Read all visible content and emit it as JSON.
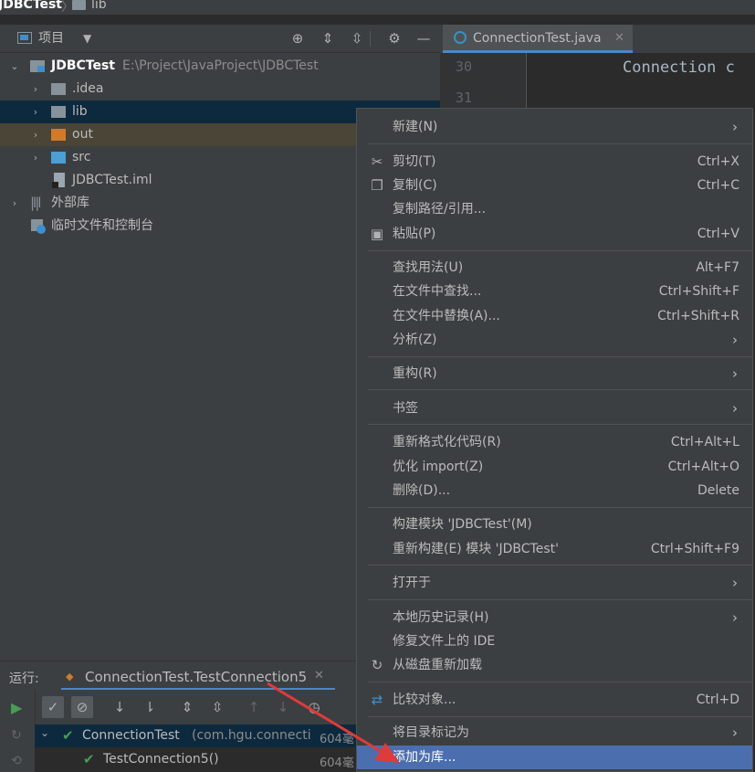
{
  "breadcrumb": {
    "project": "JDBCTest",
    "folder": "lib"
  },
  "project_panel": {
    "view_label": "项目",
    "tree": {
      "root_label": "JDBCTest",
      "root_path": "E:\\Project\\JavaProject\\JDBCTest",
      "items": [
        {
          "label": ".idea"
        },
        {
          "label": "lib"
        },
        {
          "label": "out"
        },
        {
          "label": "src"
        },
        {
          "label": "JDBCTest.iml"
        },
        {
          "label": "外部库"
        },
        {
          "label": "临时文件和控制台"
        }
      ]
    }
  },
  "editor": {
    "tab_label": "ConnectionTest.java",
    "line_numbers": [
      "30",
      "31"
    ],
    "line_30": "Connection c"
  },
  "run": {
    "label": "运行:",
    "tab_label": "ConnectionTest.TestConnection5",
    "tests": [
      {
        "name": "ConnectionTest",
        "detail": "(com.hgu.connecti",
        "time": "604毫"
      },
      {
        "name": "TestConnection5()",
        "detail": "",
        "time": "604毫"
      }
    ]
  },
  "context_menu": {
    "items": [
      {
        "label": "新建(N)",
        "shortcut": ""
      },
      {
        "label": "剪切(T)",
        "shortcut": "Ctrl+X"
      },
      {
        "label": "复制(C)",
        "shortcut": "Ctrl+C"
      },
      {
        "label": "复制路径/引用...",
        "shortcut": ""
      },
      {
        "label": "粘贴(P)",
        "shortcut": "Ctrl+V"
      },
      {
        "label": "查找用法(U)",
        "shortcut": "Alt+F7"
      },
      {
        "label": "在文件中查找...",
        "shortcut": "Ctrl+Shift+F"
      },
      {
        "label": "在文件中替换(A)...",
        "shortcut": "Ctrl+Shift+R"
      },
      {
        "label": "分析(Z)",
        "shortcut": ""
      },
      {
        "label": "重构(R)",
        "shortcut": ""
      },
      {
        "label": "书签",
        "shortcut": ""
      },
      {
        "label": "重新格式化代码(R)",
        "shortcut": "Ctrl+Alt+L"
      },
      {
        "label": "优化 import(Z)",
        "shortcut": "Ctrl+Alt+O"
      },
      {
        "label": "删除(D)...",
        "shortcut": "Delete"
      },
      {
        "label": "构建模块 'JDBCTest'(M)",
        "shortcut": ""
      },
      {
        "label": "重新构建(E) 模块 'JDBCTest'",
        "shortcut": "Ctrl+Shift+F9"
      },
      {
        "label": "打开于",
        "shortcut": ""
      },
      {
        "label": "本地历史记录(H)",
        "shortcut": ""
      },
      {
        "label": "修复文件上的 IDE",
        "shortcut": ""
      },
      {
        "label": "从磁盘重新加载",
        "shortcut": ""
      },
      {
        "label": "比较对象...",
        "shortcut": "Ctrl+D"
      },
      {
        "label": "将目录标记为",
        "shortcut": ""
      },
      {
        "label": "添加为库...",
        "shortcut": ""
      }
    ]
  },
  "colors": {
    "highlight": "#4b6eaf",
    "selected_row": "#0d293e",
    "excluded_row": "#4a4536",
    "success": "#499c54",
    "annotation_arrow": "#e03a3a"
  }
}
